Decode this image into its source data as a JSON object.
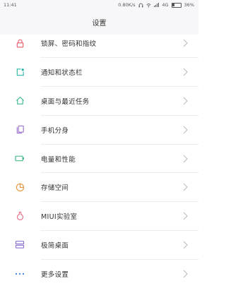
{
  "status": {
    "time": "11:41",
    "speed": "0.80K/s",
    "network": "4G",
    "battery": "36%"
  },
  "header": {
    "title": "设置"
  },
  "items": [
    {
      "label": "锁屏、密码和指纹",
      "icon": "lock-icon",
      "color": "#e85a6b"
    },
    {
      "label": "通知和状态栏",
      "icon": "notification-icon",
      "color": "#2bb5a8"
    },
    {
      "label": "桌面与最近任务",
      "icon": "home-icon",
      "color": "#3bb88a"
    },
    {
      "label": "手机分身",
      "icon": "clone-icon",
      "color": "#9b6fd0"
    },
    {
      "label": "电量和性能",
      "icon": "battery-icon",
      "color": "#36b37e"
    },
    {
      "label": "存储空间",
      "icon": "storage-pie-icon",
      "color": "#e8963a"
    },
    {
      "label": "MIUI实验室",
      "icon": "flask-icon",
      "color": "#e8708a"
    },
    {
      "label": "极简桌面",
      "icon": "simple-desktop-icon",
      "color": "#8a6fd0"
    },
    {
      "label": "更多设置",
      "icon": "more-dots-icon",
      "color": "#3a7fe0"
    }
  ]
}
